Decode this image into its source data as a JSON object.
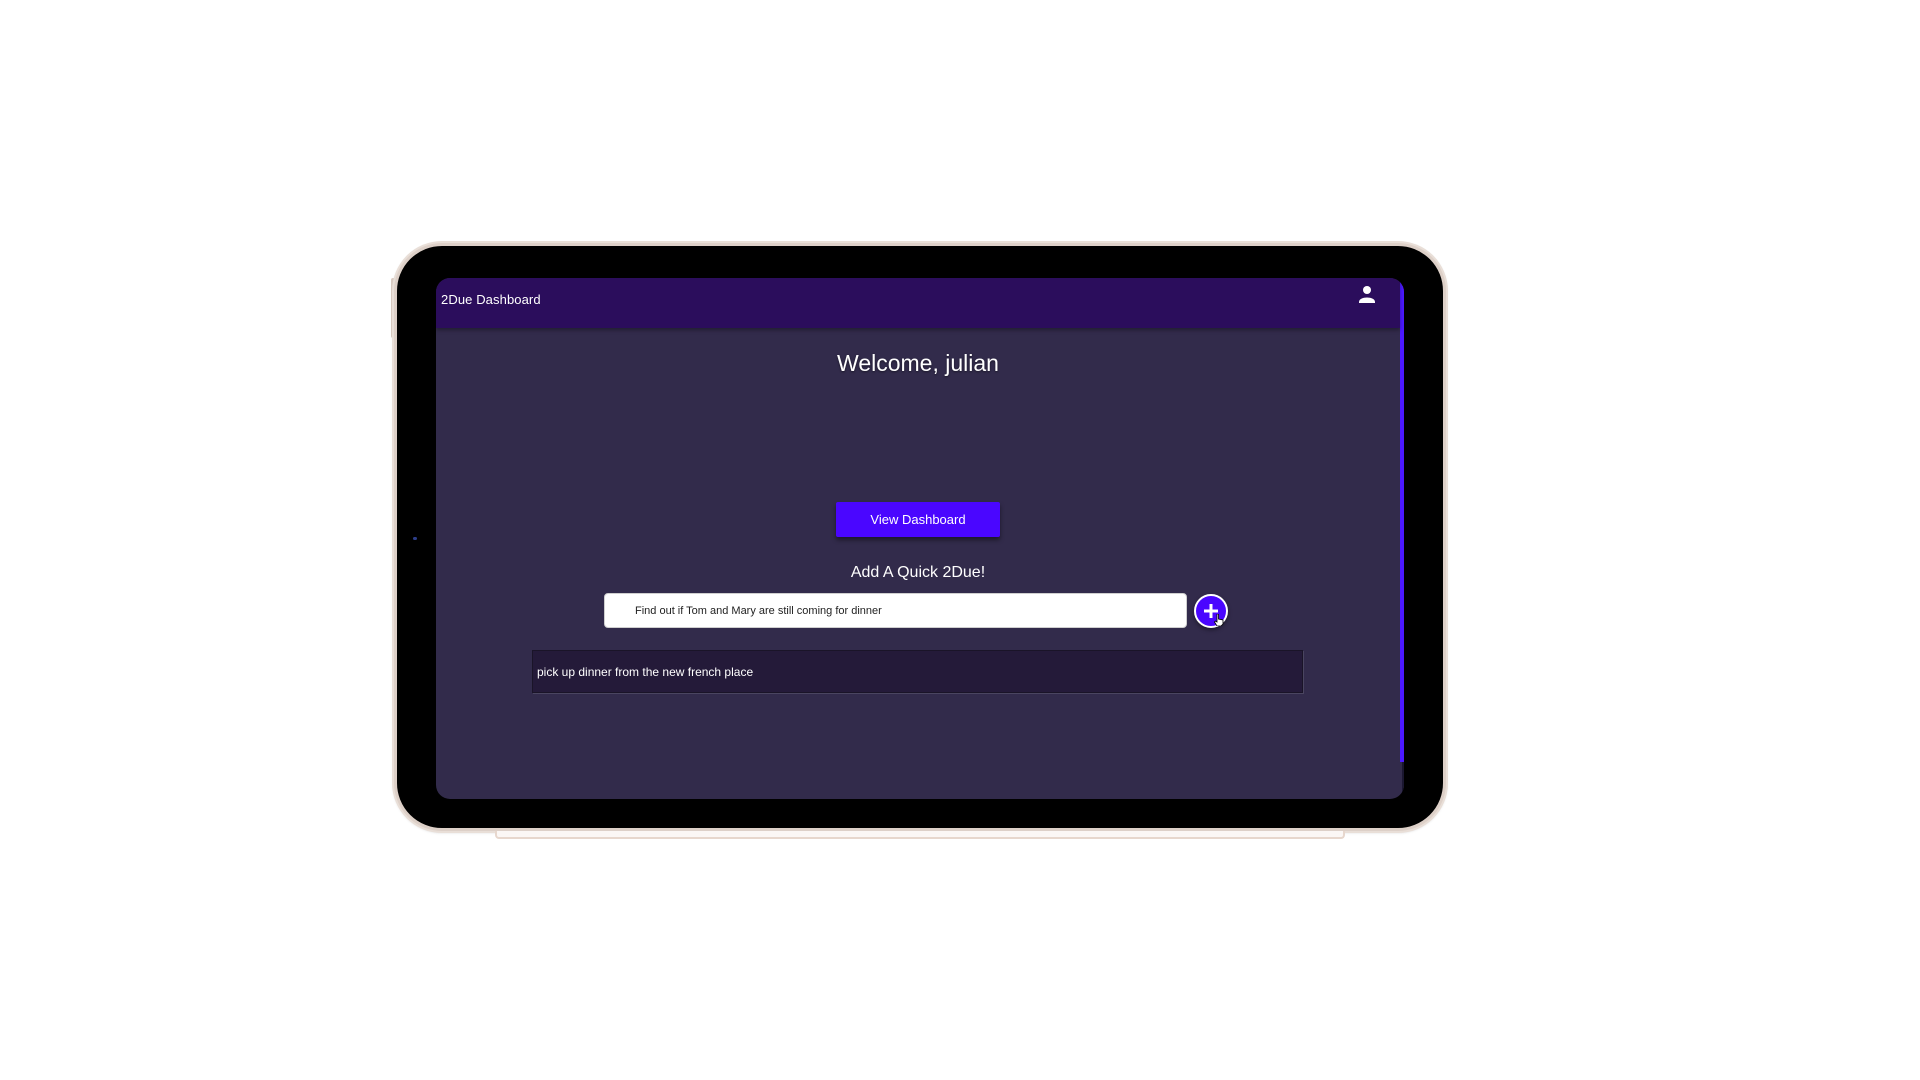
{
  "app": {
    "title": "2Due Dashboard",
    "account_icon": "person-icon"
  },
  "main": {
    "welcome_text": "Welcome, julian",
    "view_dashboard_label": "View Dashboard",
    "quick_add_heading": "Add A Quick 2Due!",
    "quick_add_input_value": "Find out if Tom and Mary are still coming for dinner",
    "add_button_icon": "plus-icon"
  },
  "todos": [
    {
      "text": "pick up dinner from the new french place"
    }
  ],
  "colors": {
    "header_bg": "#2b0d5c",
    "screen_bg": "#322b4b",
    "accent": "#4a06ff",
    "todo_bg": "#241a39"
  }
}
